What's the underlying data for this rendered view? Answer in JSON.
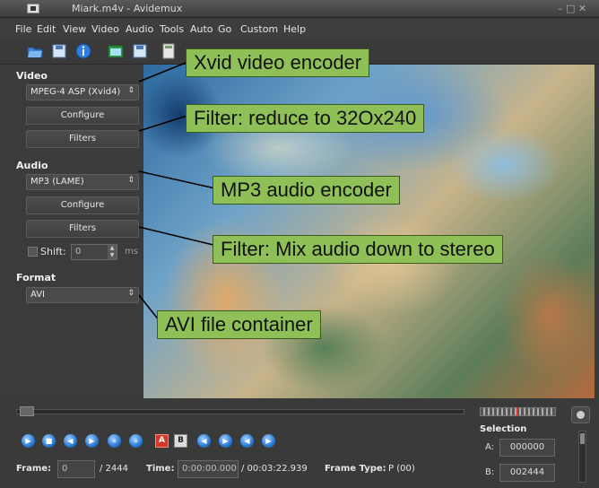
{
  "window": {
    "title": "Miark.m4v - Avidemux",
    "controls": "– □ ✕"
  },
  "menu": [
    "File",
    "Edit",
    "View",
    "Video",
    "Audio",
    "Tools",
    "Auto",
    "Go",
    "Custom",
    "Help"
  ],
  "video": {
    "section": "Video",
    "codec": "MPEG-4 ASP (Xvid4)",
    "configure": "Configure",
    "filters": "Filters"
  },
  "audio": {
    "section": "Audio",
    "codec": "MP3 (LAME)",
    "configure": "Configure",
    "filters": "Filters",
    "shift_label": "Shift:",
    "shift_value": "0",
    "shift_unit": "ms"
  },
  "format": {
    "section": "Format",
    "container": "AVI"
  },
  "callouts": {
    "video_encoder": "Xvid video encoder",
    "video_filter": "Filter: reduce to 32Ox240",
    "audio_encoder": "MP3 audio encoder",
    "audio_filter": "Filter: Mix audio down to stereo",
    "container": "AVI file container"
  },
  "status": {
    "frame_label": "Frame:",
    "frame_value": "0",
    "frame_total": "/ 2444",
    "time_label": "Time:",
    "time_value": "0:00:00.000",
    "time_total": "/ 00:03:22.939",
    "frametype_label": "Frame Type:",
    "frametype_value": "P (00)"
  },
  "selection": {
    "title": "Selection",
    "a_label": "A:",
    "a_value": "000000",
    "b_label": "B:",
    "b_value": "002444"
  },
  "colors": {
    "callout_bg": "#8fc057",
    "panel_bg": "#3b3b3b",
    "play_blue": "#2a7bd6"
  }
}
